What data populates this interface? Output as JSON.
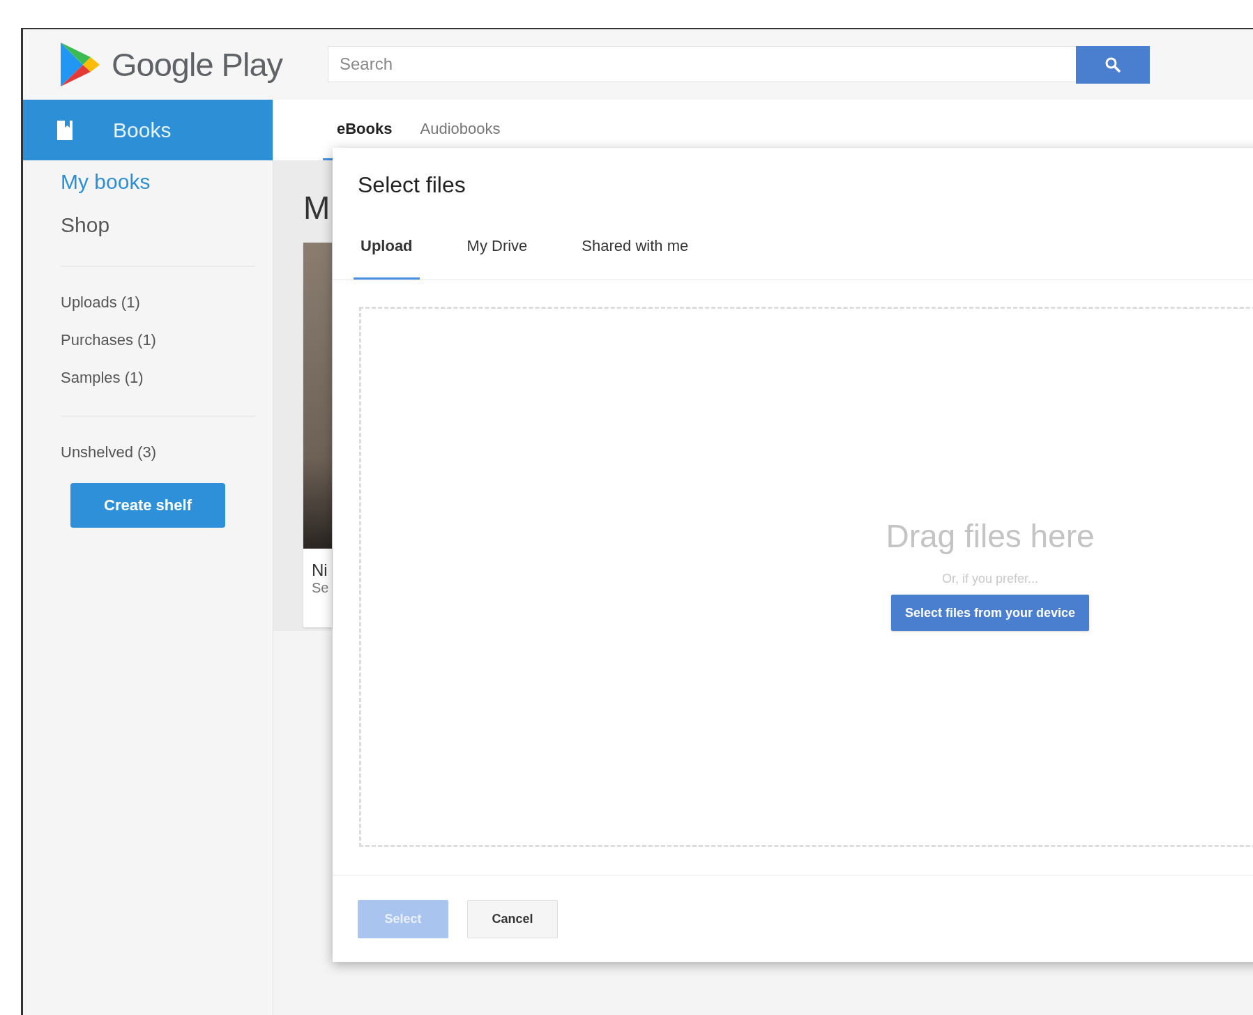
{
  "header": {
    "logo_text": "Google Play",
    "search": {
      "placeholder": "Search"
    }
  },
  "sidebar": {
    "section": {
      "label": "Books",
      "selected": true
    },
    "nav": [
      {
        "label": "My books",
        "selected": true
      },
      {
        "label": "Shop",
        "selected": false
      }
    ],
    "libraries": [
      "Uploads (1)",
      "Purchases (1)",
      "Samples (1)"
    ],
    "shelves": [
      "Unshelved (3)"
    ],
    "create_button": "Create shelf"
  },
  "main": {
    "tabs": [
      {
        "label": "eBooks",
        "selected": true
      },
      {
        "label": "Audiobooks",
        "selected": false
      }
    ],
    "heading": "M",
    "book": {
      "title": "Ni",
      "subtitle": "Se"
    }
  },
  "dialog": {
    "title": "Select files",
    "tabs": [
      {
        "label": "Upload",
        "selected": true
      },
      {
        "label": "My Drive",
        "selected": false
      },
      {
        "label": "Shared with me",
        "selected": false
      }
    ],
    "drop_zone": {
      "heading": "Drag files here",
      "hint": "Or, if you prefer...",
      "button": "Select files from your device"
    },
    "buttons": [
      {
        "label": "Select",
        "disabled": true
      },
      {
        "label": "Cancel",
        "disabled": false
      }
    ]
  }
}
